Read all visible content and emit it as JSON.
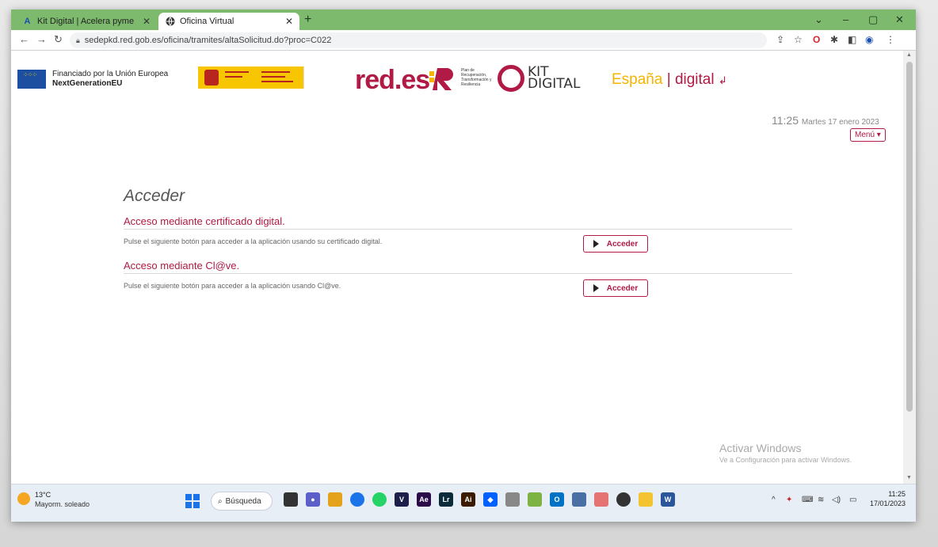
{
  "browser": {
    "tabs": [
      {
        "title": "Kit Digital | Acelera pyme",
        "favicon": "A",
        "active": false
      },
      {
        "title": "Oficina Virtual",
        "favicon": "globe-icon",
        "active": true
      }
    ],
    "url": "sedepkd.red.gob.es/oficina/tramites/altaSolicitud.do?proc=C022",
    "new_tab": "+",
    "controls": {
      "minimize": "–",
      "maximize": "▢",
      "close": "✕",
      "chevron": "⌄"
    }
  },
  "header": {
    "eu_text_line1": "Financiado por la Unión Europea",
    "eu_text_line2": "NextGenerationEU",
    "redes": "red.es",
    "prtr_text": "Plan de Recuperación, Transformación y Resiliencia",
    "kit_line1": "KIT",
    "kit_line2": "DIGITAL",
    "espana": "España",
    "espana_sep": " | ",
    "espana_digital": "digital",
    "time": "11:25",
    "date": "Martes 17 enero 2023",
    "menu": "Menú ▾"
  },
  "main": {
    "heading": "Acceder",
    "sections": [
      {
        "title": "Acceso mediante certificado digital.",
        "description": "Pulse el siguiente botón para acceder a la aplicación usando su certificado digital.",
        "button": "Acceder"
      },
      {
        "title": "Acceso mediante Cl@ve.",
        "description": "Pulse el siguiente botón para acceder a la aplicación usando Cl@ve.",
        "button": "Acceder"
      }
    ]
  },
  "watermark": {
    "line1": "Activar Windows",
    "line2": "Ve a Configuración para activar Windows."
  },
  "taskbar": {
    "temperature": "13°C",
    "weather": "Mayorm. soleado",
    "search": "Búsqueda",
    "time": "11:25",
    "date": "17/01/2023"
  },
  "colors": {
    "accent": "#b01a45",
    "tabstrip": "#7dba6e"
  }
}
